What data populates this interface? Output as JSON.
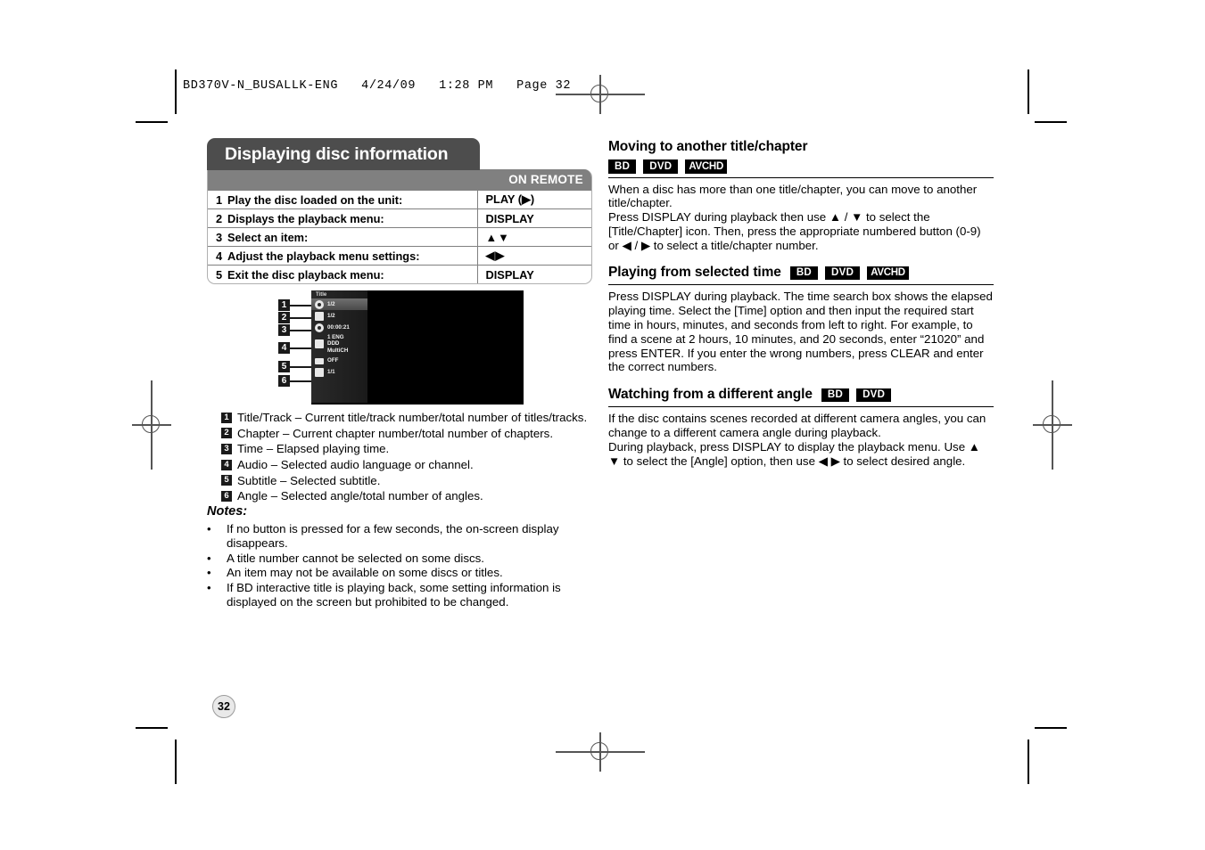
{
  "file_stamp": "BD370V-N_BUSALLK-ENG   4/24/09   1:28 PM   Page 32",
  "page_number": "32",
  "left": {
    "section_title": "Displaying disc information",
    "table": {
      "col2_header": "ON REMOTE",
      "rows": [
        {
          "num": "1",
          "action": "Play the disc loaded on the unit:",
          "remote": "PLAY (▶)"
        },
        {
          "num": "2",
          "action": "Displays the playback menu:",
          "remote": "DISPLAY"
        },
        {
          "num": "3",
          "action": "Select an item:",
          "remote": "▲▼"
        },
        {
          "num": "4",
          "action": "Adjust the playback menu settings:",
          "remote": "◀▶"
        },
        {
          "num": "5",
          "action": "Exit the disc playback menu:",
          "remote": "DISPLAY"
        }
      ]
    },
    "osd": {
      "title": "Title",
      "items": [
        {
          "callout": "1",
          "icon": "disc-icon",
          "value": "1/2"
        },
        {
          "callout": "2",
          "icon": "chapter-icon",
          "value": "1/2"
        },
        {
          "callout": "3",
          "icon": "time-icon",
          "value": "00:00:21"
        },
        {
          "callout": "4",
          "icon": "audio-icon",
          "value": "1 ENG\nDDD\nMultiCH"
        },
        {
          "callout": "5",
          "icon": "subtitle-icon",
          "value": "OFF"
        },
        {
          "callout": "6",
          "icon": "angle-icon",
          "value": "1/1"
        }
      ]
    },
    "legend": [
      {
        "num": "1",
        "text": "Title/Track – Current title/track number/total number of titles/tracks."
      },
      {
        "num": "2",
        "text": "Chapter – Current chapter number/total number of chapters."
      },
      {
        "num": "3",
        "text": "Time – Elapsed playing time."
      },
      {
        "num": "4",
        "text": "Audio – Selected audio language or channel."
      },
      {
        "num": "5",
        "text": "Subtitle – Selected subtitle."
      },
      {
        "num": "6",
        "text": "Angle – Selected angle/total number of angles."
      }
    ],
    "notes_title": "Notes:",
    "notes": [
      "If no button is pressed for a few seconds, the on-screen display disappears.",
      "A title number cannot be selected on some discs.",
      "An item may not be available on some discs or titles.",
      "If BD interactive title is playing back, some setting information is displayed on the screen but prohibited to be changed."
    ],
    "bullet": "•"
  },
  "right": {
    "sections": [
      {
        "heading": "Moving to another title/chapter",
        "badges": [
          "BD",
          "DVD",
          "AVCHD"
        ],
        "badges_below": true,
        "paragraphs": [
          "When a disc has more than one title/chapter, you can move to another title/chapter.",
          "Press DISPLAY during playback then use ▲ / ▼ to select the [Title/Chapter] icon. Then, press the appropriate numbered button (0-9) or ◀ / ▶ to select a title/chapter number."
        ]
      },
      {
        "heading": "Playing from selected time",
        "badges": [
          "BD",
          "DVD",
          "AVCHD"
        ],
        "badges_below": false,
        "paragraphs": [
          "Press DISPLAY during playback. The time search box shows the elapsed playing time. Select the [Time] option and then input the required start time in hours, minutes, and seconds from left to right. For example, to find a scene at 2 hours, 10 minutes, and 20 seconds, enter “21020” and press ENTER. If you enter the wrong numbers, press CLEAR and enter the correct numbers."
        ]
      },
      {
        "heading": "Watching from a different angle",
        "badges": [
          "BD",
          "DVD"
        ],
        "badges_below": false,
        "paragraphs": [
          "If the disc contains scenes recorded at different camera angles, you can change to a different camera angle during playback.",
          "During playback, press DISPLAY to display the playback menu. Use ▲ ▼ to select the [Angle] option, then use ◀ ▶ to select desired angle."
        ]
      }
    ]
  },
  "colors": {
    "title_bar": "#4d4d4d",
    "table_header": "#808080",
    "badge": "#000000"
  }
}
